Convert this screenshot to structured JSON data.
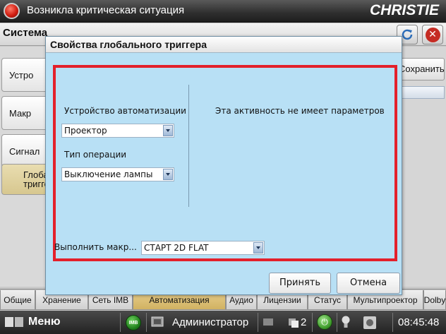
{
  "topbar": {
    "title": "Возникла критическая ситуация",
    "logo": "CHRISTIE"
  },
  "page": {
    "title": "Система"
  },
  "background": {
    "side_tabs": [
      "Устро",
      "Макр",
      "Сигнал",
      "Глоба\nтригге"
    ],
    "save_label": "Сохранить"
  },
  "bottom_tabs": [
    "Общие",
    "Хранение",
    "Сеть IMB",
    "Автоматизация",
    "Аудио",
    "Лицензии",
    "Статус",
    "Мультипроектор",
    "Dolby"
  ],
  "statusbar": {
    "menu": "Меню",
    "imb_icon_text": "IMB",
    "user": "Администратор",
    "alerts_count": "2",
    "time": "08:45:48"
  },
  "dialog": {
    "title": "Свойства глобального триггера",
    "device_label": "Устройство автоматизации",
    "device_value": "Проектор",
    "operation_label": "Тип операции",
    "operation_value": "Выключение лампы",
    "no_params_text": "Эта активность не имеет параметров",
    "macro_label": "Выполнить макр...",
    "macro_value": "СТАРТ 2D FLAT",
    "accept_label": "Принять",
    "cancel_label": "Отмена"
  },
  "colors": {
    "dialog_bg": "#b8e0f5",
    "highlight": "#e3202b",
    "active_tab": "#d7c78f"
  }
}
